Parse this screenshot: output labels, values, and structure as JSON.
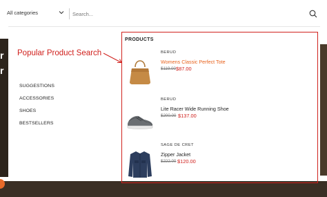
{
  "search": {
    "category_label": "All categories",
    "placeholder": "Search..."
  },
  "categories": [
    "SUGGESTIONS",
    "ACCESSORIES",
    "SHOES",
    "BESTSELLERS"
  ],
  "annotation": "Popular Product Search",
  "products_section": {
    "title": "PRODUCTS",
    "items": [
      {
        "brand": "BERUD",
        "name": "Womens Classic Perfect Tote",
        "old_price": "$119.00",
        "new_price": "$87.00"
      },
      {
        "brand": "BERUD",
        "name": "Lite Racer Wide Running Shoe",
        "old_price": "$200.00",
        "new_price": "$137.00"
      },
      {
        "brand": "SAGE DE CRET",
        "name": "Zipper Jacket",
        "old_price": "$222.00",
        "new_price": "$120.00"
      }
    ]
  },
  "colors": {
    "accent_red": "#d0201c",
    "link_orange": "#e8621c"
  }
}
